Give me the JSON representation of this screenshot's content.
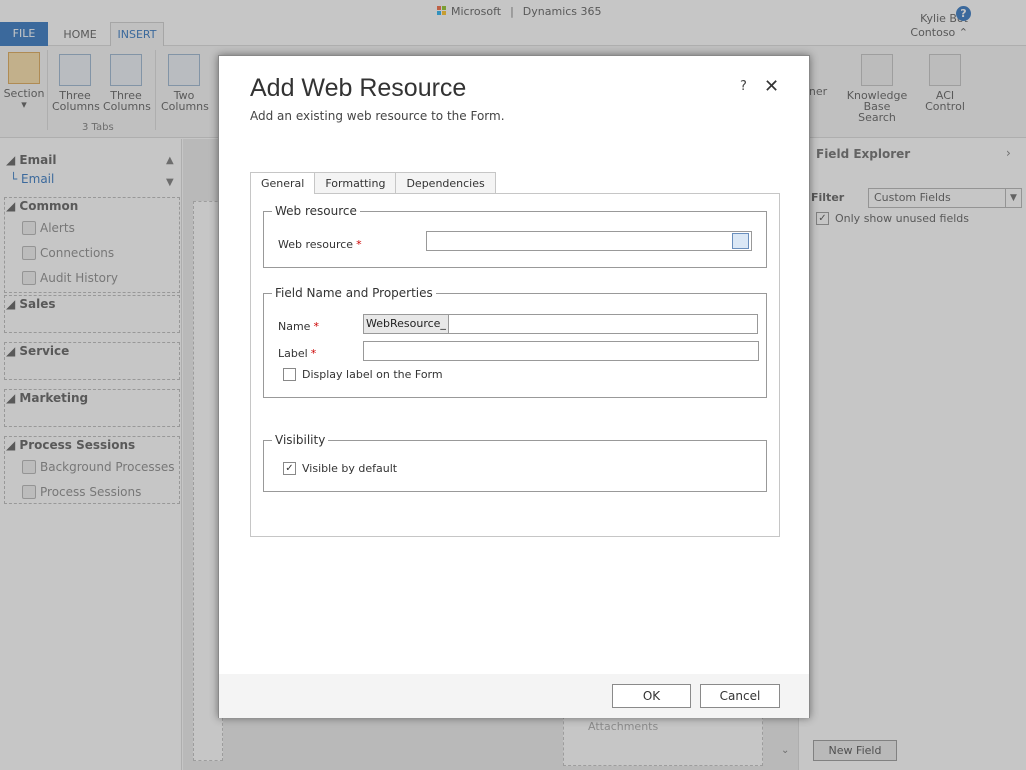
{
  "header": {
    "brand_company": "Microsoft",
    "brand_product": "Dynamics 365",
    "user_name": "Kylie Bot",
    "org_name": "Contoso",
    "help_symbol": "?",
    "org_toggle_symbol": "⌃"
  },
  "ribbon_tabs": {
    "file": "FILE",
    "home": "HOME",
    "insert": "INSERT"
  },
  "ribbon": {
    "section": "Section",
    "three_columns_1": [
      "Three",
      "Columns"
    ],
    "three_columns_2": [
      "Three",
      "Columns"
    ],
    "two_columns": [
      "Two",
      "Columns"
    ],
    "group_label": "3 Tabs",
    "timer_partial": "ner",
    "kb_search": [
      "Knowledge Base",
      "Search"
    ],
    "aci_control": [
      "ACI",
      "Control"
    ]
  },
  "left_nav": {
    "email_header": "Email",
    "email_item": "Email",
    "common_header": "Common",
    "common_items": [
      "Alerts",
      "Connections",
      "Audit History"
    ],
    "sales_header": "Sales",
    "service_header": "Service",
    "marketing_header": "Marketing",
    "process_header": "Process Sessions",
    "process_items": [
      "Background Processes",
      "Process Sessions"
    ]
  },
  "field_explorer": {
    "title": "Field Explorer",
    "filter_label": "Filter",
    "filter_value": "Custom Fields",
    "unused_label": "Only show unused fields",
    "unused_checked": true,
    "new_field_label": "New Field"
  },
  "canvas": {
    "attachments": "Attachments"
  },
  "dialog": {
    "title": "Add Web Resource",
    "subtitle": "Add an existing web resource to the Form.",
    "help": "?",
    "close": "✕",
    "tabs": [
      "General",
      "Formatting",
      "Dependencies"
    ],
    "web_resource_legend": "Web resource",
    "web_resource_label": "Web resource",
    "web_resource_value": "",
    "field_legend": "Field Name and Properties",
    "name_label": "Name",
    "name_prefix": "WebResource_",
    "name_value": "",
    "label_label": "Label",
    "label_value": "",
    "display_label_text": "Display label on the Form",
    "display_label_checked": false,
    "visibility_legend": "Visibility",
    "visible_text": "Visible by default",
    "visible_checked": true,
    "ok": "OK",
    "cancel": "Cancel",
    "required_marker": "*"
  },
  "colors": {
    "accent": "#1160b7",
    "required": "#cc0000"
  }
}
